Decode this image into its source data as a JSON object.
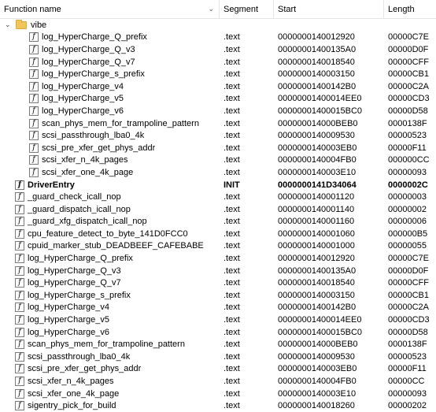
{
  "columns": {
    "name": "Function name",
    "segment": "Segment",
    "start": "Start",
    "length": "Length"
  },
  "folder": {
    "label": "vibe",
    "expanded": true
  },
  "folder_items": [
    {
      "name": "log_HyperCharge_Q_prefix",
      "segment": ".text",
      "start": "0000000140012920",
      "length": "00000C7E"
    },
    {
      "name": "log_HyperCharge_Q_v3",
      "segment": ".text",
      "start": "00000001400135A0",
      "length": "00000D0F"
    },
    {
      "name": "log_HyperCharge_Q_v7",
      "segment": ".text",
      "start": "0000000140018540",
      "length": "00000CFF"
    },
    {
      "name": "log_HyperCharge_s_prefix",
      "segment": ".text",
      "start": "0000000140003150",
      "length": "00000CB1"
    },
    {
      "name": "log_HyperCharge_v4",
      "segment": ".text",
      "start": "00000001400142B0",
      "length": "00000C2A"
    },
    {
      "name": "log_HyperCharge_v5",
      "segment": ".text",
      "start": "00000001400014EE0",
      "length": "00000CD3"
    },
    {
      "name": "log_HyperCharge_v6",
      "segment": ".text",
      "start": "00000001400015BC0",
      "length": "00000D58"
    },
    {
      "name": "scan_phys_mem_for_trampoline_pattern",
      "segment": ".text",
      "start": "000000014000BEB0",
      "length": "0000138F"
    },
    {
      "name": "scsi_passthrough_lba0_4k",
      "segment": ".text",
      "start": "0000000140009530",
      "length": "00000523"
    },
    {
      "name": "scsi_pre_xfer_get_phys_addr",
      "segment": ".text",
      "start": "0000000140003EB0",
      "length": "00000F11"
    },
    {
      "name": "scsi_xfer_n_4k_pages",
      "segment": ".text",
      "start": "0000000140004FB0",
      "length": "000000CC"
    },
    {
      "name": "scsi_xfer_one_4k_page",
      "segment": ".text",
      "start": "0000000140003E10",
      "length": "00000093"
    }
  ],
  "functions": [
    {
      "name": "DriverEntry",
      "segment": "INIT",
      "start": "0000000141D34064",
      "length": "0000002C",
      "bold": true
    },
    {
      "name": "_guard_check_icall_nop",
      "segment": ".text",
      "start": "0000000140001120",
      "length": "00000003"
    },
    {
      "name": "_guard_dispatch_icall_nop",
      "segment": ".text",
      "start": "0000000140001140",
      "length": "00000002"
    },
    {
      "name": "_guard_xfg_dispatch_icall_nop",
      "segment": ".text",
      "start": "0000000140001160",
      "length": "00000006"
    },
    {
      "name": "cpu_feature_detect_to_byte_141D0FCC0",
      "segment": ".text",
      "start": "0000000140001060",
      "length": "000000B5"
    },
    {
      "name": "cpuid_marker_stub_DEADBEEF_CAFEBABE",
      "segment": ".text",
      "start": "0000000140001000",
      "length": "00000055"
    },
    {
      "name": "log_HyperCharge_Q_prefix",
      "segment": ".text",
      "start": "0000000140012920",
      "length": "00000C7E"
    },
    {
      "name": "log_HyperCharge_Q_v3",
      "segment": ".text",
      "start": "00000001400135A0",
      "length": "00000D0F"
    },
    {
      "name": "log_HyperCharge_Q_v7",
      "segment": ".text",
      "start": "0000000140018540",
      "length": "00000CFF"
    },
    {
      "name": "log_HyperCharge_s_prefix",
      "segment": ".text",
      "start": "0000000140003150",
      "length": "00000CB1"
    },
    {
      "name": "log_HyperCharge_v4",
      "segment": ".text",
      "start": "00000001400142B0",
      "length": "00000C2A"
    },
    {
      "name": "log_HyperCharge_v5",
      "segment": ".text",
      "start": "00000001400014EE0",
      "length": "00000CD3"
    },
    {
      "name": "log_HyperCharge_v6",
      "segment": ".text",
      "start": "00000001400015BC0",
      "length": "00000D58"
    },
    {
      "name": "scan_phys_mem_for_trampoline_pattern",
      "segment": ".text",
      "start": "000000014000BEB0",
      "length": "0000138F"
    },
    {
      "name": "scsi_passthrough_lba0_4k",
      "segment": ".text",
      "start": "0000000140009530",
      "length": "00000523"
    },
    {
      "name": "scsi_pre_xfer_get_phys_addr",
      "segment": ".text",
      "start": "0000000140003EB0",
      "length": "00000F11"
    },
    {
      "name": "scsi_xfer_n_4k_pages",
      "segment": ".text",
      "start": "0000000140004FB0",
      "length": "00000CC"
    },
    {
      "name": "scsi_xfer_one_4k_page",
      "segment": ".text",
      "start": "0000000140003E10",
      "length": "00000093"
    },
    {
      "name": "sigentry_pick_for_build",
      "segment": ".text",
      "start": "0000000140018260",
      "length": "00000202"
    }
  ]
}
